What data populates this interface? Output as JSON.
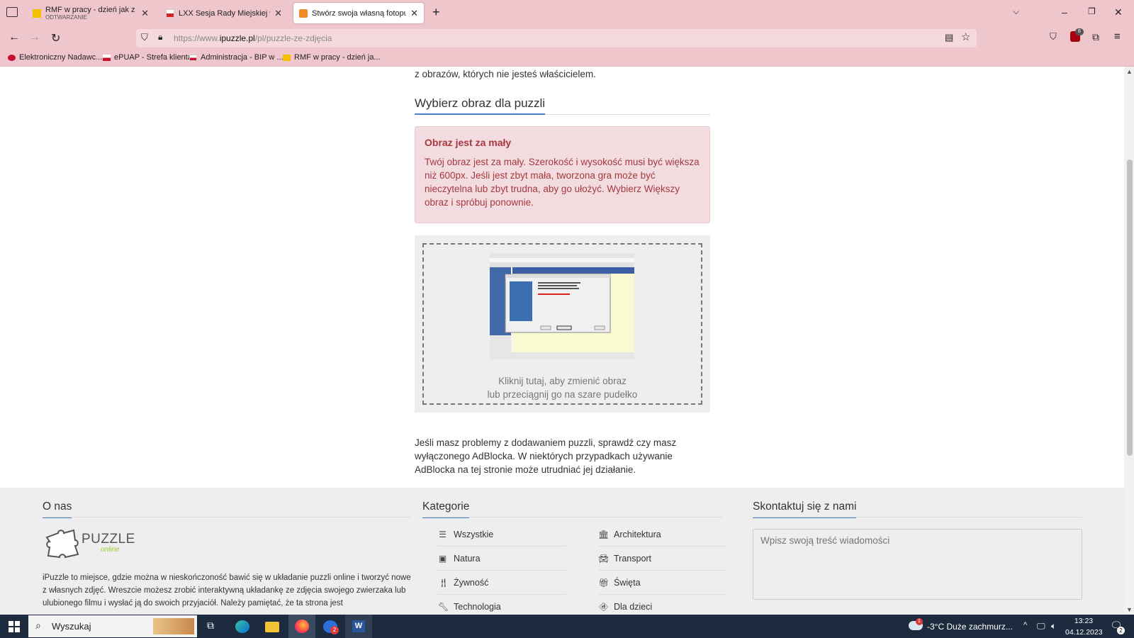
{
  "browser": {
    "tabs": [
      {
        "title": "RMF w pracy - dzień jak z nut -",
        "subtitle": "ODTWARZANIE",
        "active": false
      },
      {
        "title": "LXX Sesja Rady Miejskiej w Mro",
        "active": false
      },
      {
        "title": "Stwórz swoja własną fotopuzzle",
        "active": true
      }
    ],
    "url_prefix": "https://www.",
    "url_domain": "ipuzzle.pl",
    "url_path": "/pl/puzzle-ze-zdjęcia",
    "extension_badge": "6",
    "bookmarks": [
      "Elektroniczny Nadawc...",
      "ePUAP - Strefa klienta",
      "Administracja - BIP w ...",
      "RMF w pracy - dzień ja..."
    ]
  },
  "page": {
    "intro_fragment": "z obrazów, których nie jesteś właścicielem.",
    "section_title": "Wybierz obraz dla puzzli",
    "alert": {
      "title": "Obraz jest za mały",
      "body": "Twój obraz jest za mały. Szerokość i wysokość musi być większa niż 600px. Jeśli jest zbyt mała, tworzona gra może być nieczytelna lub zbyt trudna, aby go ułożyć. Wybierz Większy obraz i spróbuj ponownie."
    },
    "dropzone": {
      "line1": "Kliknij tutaj, aby zmienić obraz",
      "line2": "lub przeciągnij go na szare pudełko"
    },
    "adblock_note": "Jeśli masz problemy z dodawaniem puzzli, sprawdź czy masz wyłączonego AdBlocka. W niektórych przypadkach używanie AdBlocka na tej stronie może utrudniać jej działanie."
  },
  "footer": {
    "about_title": "O nas",
    "logo_text": "PUZZLE",
    "logo_sub": "online",
    "about_text": "iPuzzle to miejsce, gdzie można w nieskończoność bawić się w układanie puzzli online i tworzyć nowe z własnych zdjęć. Wreszcie możesz zrobić interaktywną układankę ze zdjęcia swojego zwierzaka lub ulubionego filmu i wysłać ją do swoich przyjaciół. Należy pamiętać, że ta strona jest",
    "categories_title": "Kategorie",
    "categories": [
      {
        "label": "Wszystkie",
        "icon": "list-icon"
      },
      {
        "label": "Architektura",
        "icon": "bank-icon"
      },
      {
        "label": "Natura",
        "icon": "image-icon"
      },
      {
        "label": "Transport",
        "icon": "car-icon"
      },
      {
        "label": "Żywność",
        "icon": "cutlery-icon"
      },
      {
        "label": "Święta",
        "icon": "gifts-icon"
      },
      {
        "label": "Technologia",
        "icon": "wrench-icon"
      },
      {
        "label": "Dla dzieci",
        "icon": "child-icon"
      }
    ],
    "contact_title": "Skontaktuj się z nami",
    "message_placeholder": "Wpisz swoją treść wiadomości"
  },
  "taskbar": {
    "search_label": "Wyszukaj",
    "weather": "-3°C  Duże zachmurz...",
    "weather_badge": "1",
    "time": "13:23",
    "date": "04.12.2023",
    "notification_count": "2"
  }
}
